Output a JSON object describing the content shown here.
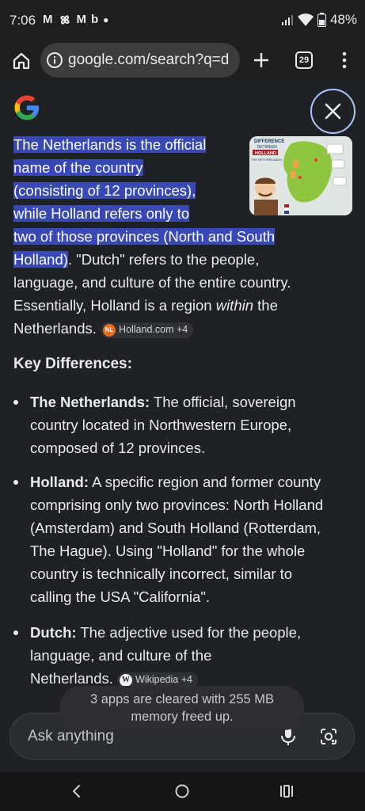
{
  "status_bar": {
    "time": "7:06",
    "notification_icons": [
      "gmail-icon",
      "pinwheel-icon",
      "gmail-icon",
      "bereal-icon",
      "dot-icon"
    ],
    "battery": "48%"
  },
  "browser": {
    "url": "google.com/search?q=d",
    "tab_count": "29"
  },
  "answer": {
    "highlighted_lines": [
      "The Netherlands is the official",
      "name of the country",
      "(consisting of 12 provinces),",
      "while Holland refers only to",
      "two of those provinces (North and South"
    ],
    "line6_highlight": "Holland)",
    "line6_rest": ". \"Dutch\" refers to the people,",
    "line7": "language, and culture of the entire country.",
    "line8_pre": "Essentially, Holland is a region ",
    "line8_em": "within",
    "line8_post": " the",
    "line9": "Netherlands.",
    "source_chip": {
      "badge": "NL",
      "label": "Holland.com +4"
    }
  },
  "thumbnail": {
    "title_line1": "DIFFERENCE",
    "title_line2": "BETWEEN",
    "title_line3": "HOLLAND",
    "title_line4": "THE NETHERLANDS"
  },
  "key_differences": {
    "title": "Key Differences:",
    "items": [
      {
        "term": "The Netherlands:",
        "lines": [
          " The official, sovereign",
          "country located in Northwestern Europe,",
          "composed of 12 provinces."
        ]
      },
      {
        "term": "Holland:",
        "lines": [
          " A specific region and former county",
          "comprising only two provinces: North Holland",
          "(Amsterdam) and South Holland (Rotterdam,",
          "The Hague). Using \"Holland\" for the whole",
          "country is technically incorrect, similar to",
          "calling the USA \"California\"."
        ]
      },
      {
        "term": "Dutch:",
        "lines": [
          " The adjective used for the people,",
          "language, and culture of the",
          "Netherlands."
        ],
        "chip": {
          "badge": "W",
          "label": "Wikipedia +4"
        }
      }
    ]
  },
  "toast": {
    "line1": "3 apps are cleared with 255 MB",
    "line2": "memory freed up."
  },
  "ask_bar": {
    "placeholder": "Ask anything"
  },
  "colors": {
    "highlight": "#3848b5",
    "background": "#202124",
    "close_ring": "#a8c7fa"
  }
}
